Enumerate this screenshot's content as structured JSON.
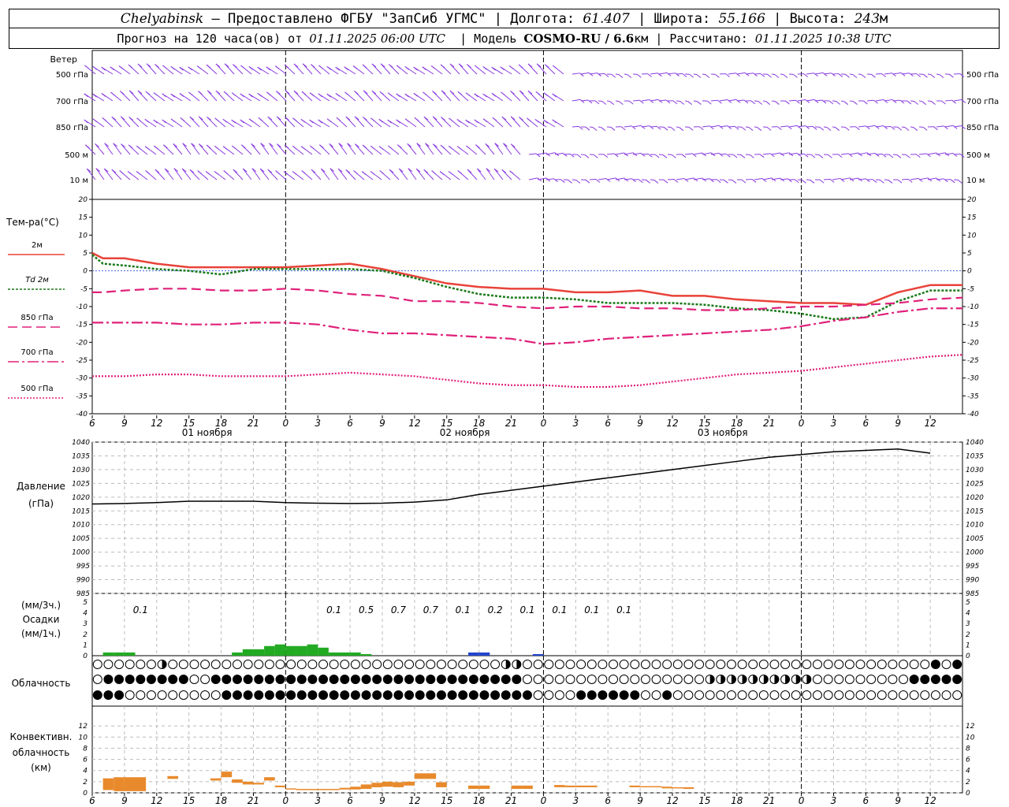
{
  "header": {
    "city": "Chelyabinsk",
    "provider": "– Предоставлено ФГБУ \"ЗапСиб УГМС\"",
    "lon_label": "Долгота:",
    "lon_value": "61.407",
    "lat_label": "Широта:",
    "lat_value": "55.166",
    "alt_label": "Высота:",
    "alt_value": "243",
    "alt_unit": "м",
    "forecast_prefix": "Прогноз на 120 часа(ов) от",
    "forecast_start": "01.11.2025 06:00 UTC",
    "model_label": "Модель",
    "model_name": "COSMO-RU / 6.6",
    "model_unit": "км",
    "calc_label": "Рассчитано:",
    "calc_time": "01.11.2025 10:38 UTC"
  },
  "wind_panel": {
    "title": "Ветер",
    "levels": [
      "500 гПа",
      "700 гПа",
      "850 гПа",
      "500 м",
      "10  м"
    ]
  },
  "temp_panel": {
    "title": "Тем-ра(°С)",
    "legend": [
      {
        "label": "2м",
        "color": "#e8433a",
        "dash": ""
      },
      {
        "label": "Td  2м",
        "color": "#1a7a1a",
        "dash": "3,2"
      },
      {
        "label": "850 гПа",
        "color": "#e0207a",
        "dash": "12,6"
      },
      {
        "label": "700 гПа",
        "color": "#e0207a",
        "dash": "14,4,3,4"
      },
      {
        "label": "500 гПа",
        "color": "#e0207a",
        "dash": "2,2"
      }
    ]
  },
  "pressure_panel": {
    "title": "Давление",
    "unit": "(гПа)"
  },
  "precip_panel": {
    "unit_top": "(мм/3ч.)",
    "title": "Осадки",
    "unit_bottom": "(мм/1ч.)",
    "totals": [
      {
        "hour": 9,
        "text": "0.1"
      },
      {
        "hour": 27,
        "text": "0.1"
      },
      {
        "hour": 30,
        "text": "0.5"
      },
      {
        "hour": 33,
        "text": "0.7"
      },
      {
        "hour": 36,
        "text": "0.7"
      },
      {
        "hour": 39,
        "text": "0.1"
      },
      {
        "hour": 42,
        "text": "0.2"
      },
      {
        "hour": 45,
        "text": "0.1"
      },
      {
        "hour": 48,
        "text": "0.1"
      },
      {
        "hour": 51,
        "text": "0.1"
      },
      {
        "hour": 54,
        "text": "0.1"
      }
    ]
  },
  "cloud_panel": {
    "title": "Облачность"
  },
  "conv_panel": {
    "line1": "Конвективн.",
    "line2": "облачность",
    "line3": "(км)"
  },
  "x_ticks": [
    "6",
    "9",
    "12",
    "15",
    "18",
    "21",
    "0",
    "3",
    "6",
    "9",
    "12",
    "15",
    "18",
    "21",
    "0",
    "3",
    "6",
    "9",
    "12",
    "15",
    "18",
    "21",
    "0",
    "3",
    "6",
    "9",
    "12"
  ],
  "date_labels": [
    {
      "hour": 12,
      "text": "01 ноября"
    },
    {
      "hour": 36,
      "text": "02 ноября"
    },
    {
      "hour": 60,
      "text": "03 ноября"
    }
  ],
  "chart_data": [
    {
      "type": "line",
      "title": "Тем-ра(°С)",
      "x_hours_from_start": [
        0,
        1,
        3,
        6,
        9,
        12,
        15,
        18,
        21,
        24,
        27,
        30,
        33,
        36,
        39,
        42,
        45,
        48,
        51,
        54,
        57,
        60,
        63,
        66,
        69,
        72,
        75,
        78,
        81
      ],
      "x_start": "01.11.2025 06:00 UTC",
      "ylim": [
        -40,
        20
      ],
      "y_ticks": [
        20,
        15,
        10,
        5,
        0,
        -5,
        -10,
        -15,
        -20,
        -25,
        -30,
        -35,
        -40
      ],
      "series": [
        {
          "name": "2м",
          "color": "#e8433a",
          "values": [
            5,
            3.5,
            3.5,
            2,
            1,
            1,
            1,
            1,
            1.5,
            2,
            0.5,
            -1.5,
            -3.5,
            -4.5,
            -5,
            -5,
            -6,
            -6,
            -5.5,
            -7,
            -7,
            -8,
            -8.5,
            -9,
            -9,
            -9.5,
            -6,
            -4,
            -4
          ]
        },
        {
          "name": "Td 2м",
          "color": "#1a7a1a",
          "values": [
            4.5,
            2,
            1.5,
            0.5,
            0,
            -1,
            0.5,
            0.5,
            0.5,
            0.5,
            0,
            -2,
            -4.5,
            -6.5,
            -7.5,
            -7.5,
            -8,
            -9,
            -9,
            -9,
            -9.5,
            -10.5,
            -11,
            -12,
            -13.5,
            -13,
            -8.5,
            -5.5,
            -5.5
          ]
        },
        {
          "name": "850 гПа",
          "color": "#e0207a",
          "values": [
            -6,
            -6,
            -5.5,
            -5,
            -5,
            -5.5,
            -5.5,
            -5,
            -5.5,
            -6.5,
            -7,
            -8.5,
            -8.5,
            -9,
            -10,
            -10.5,
            -10,
            -10,
            -10.5,
            -10.5,
            -11,
            -11,
            -10.5,
            -10,
            -10,
            -9.5,
            -9,
            -8,
            -7.5
          ]
        },
        {
          "name": "700 гПа",
          "color": "#e0207a",
          "values": [
            -14.5,
            -14.5,
            -14.5,
            -14.5,
            -15,
            -15,
            -14.5,
            -14.5,
            -15,
            -16.5,
            -17.5,
            -17.5,
            -18,
            -18.5,
            -19,
            -20.5,
            -20,
            -19,
            -18.5,
            -18,
            -17.5,
            -17,
            -16.5,
            -15.5,
            -14,
            -13,
            -11.5,
            -10.5,
            -10.5
          ]
        },
        {
          "name": "500 гПа",
          "color": "#e0207a",
          "values": [
            -29.5,
            -29.5,
            -29.5,
            -29,
            -29,
            -29.5,
            -29.5,
            -29.5,
            -29,
            -28.5,
            -29,
            -29.5,
            -30.5,
            -31.5,
            -32,
            -32,
            -32.5,
            -32.5,
            -32,
            -31,
            -30,
            -29,
            -28.5,
            -28,
            -27,
            -26,
            -25,
            -24,
            -23.5
          ]
        }
      ]
    },
    {
      "type": "line",
      "title": "Давление",
      "ylabel": "(гПа)",
      "x_hours_from_start": [
        0,
        3,
        6,
        9,
        12,
        15,
        18,
        21,
        24,
        27,
        30,
        33,
        36,
        39,
        42,
        45,
        48,
        51,
        54,
        57,
        60,
        63,
        66,
        69,
        72,
        75,
        78
      ],
      "ylim": [
        985,
        1040
      ],
      "y_ticks": [
        1040,
        1035,
        1030,
        1025,
        1020,
        1015,
        1010,
        1005,
        1000,
        995,
        990,
        985
      ],
      "series": [
        {
          "name": "",
          "color": "#000000",
          "values": [
            1017.5,
            1017.7,
            1018,
            1018.5,
            1018.5,
            1018.5,
            1018,
            1017.8,
            1017.7,
            1017.8,
            1018.2,
            1019,
            1021,
            1022.5,
            1024,
            1025.5,
            1027,
            1028.5,
            1030,
            1031.5,
            1033,
            1034.5,
            1035.5,
            1036.5,
            1037,
            1037.5,
            1036
          ]
        }
      ]
    },
    {
      "type": "bar",
      "title": "Осадки",
      "ylabel": "(мм/1ч.)",
      "ylim": [
        0,
        5
      ],
      "series": [
        {
          "name": "",
          "color": "#22aa22",
          "bars": [
            [
              1,
              0.1
            ],
            [
              2,
              0.1
            ],
            [
              3,
              0.1
            ],
            [
              13,
              0.1
            ],
            [
              14,
              0.2
            ],
            [
              15,
              0.2
            ],
            [
              16,
              0.3
            ],
            [
              17,
              0.35
            ],
            [
              18,
              0.3
            ],
            [
              19,
              0.3
            ],
            [
              20,
              0.35
            ],
            [
              21,
              0.25
            ],
            [
              22,
              0.1
            ],
            [
              23,
              0.1
            ],
            [
              24,
              0.1
            ],
            [
              25,
              0.05
            ]
          ]
        },
        {
          "name": "",
          "color": "#2244cc",
          "bars": [
            [
              35,
              0.1
            ],
            [
              36,
              0.1
            ],
            [
              41,
              0.05
            ]
          ]
        }
      ]
    },
    {
      "type": "bar",
      "title": "Конвективн. облачность",
      "ylabel": "(км)",
      "ylim": [
        0,
        14
      ],
      "y_ticks": [
        12,
        10,
        8,
        6,
        4,
        2,
        0
      ],
      "series": [
        {
          "name": "",
          "color": "#e88a2c",
          "bars": [
            [
              1,
              0.5,
              2.6
            ],
            [
              2,
              0.3,
              2.8
            ],
            [
              3,
              0.3,
              2.8
            ],
            [
              4,
              0.3,
              2.8
            ],
            [
              7,
              2.5,
              3.0
            ],
            [
              11,
              2.2,
              2.6
            ],
            [
              12,
              2.8,
              3.8
            ],
            [
              13,
              1.8,
              2.4
            ],
            [
              14,
              1.5,
              2.0
            ],
            [
              15,
              1.5,
              1.8
            ],
            [
              16,
              2.2,
              2.8
            ],
            [
              17,
              1.0,
              1.3
            ],
            [
              18,
              0.6,
              0.8
            ],
            [
              19,
              0.5,
              0.7
            ],
            [
              20,
              0.5,
              0.7
            ],
            [
              21,
              0.5,
              0.7
            ],
            [
              22,
              0.5,
              0.7
            ],
            [
              23,
              0.6,
              0.9
            ],
            [
              24,
              0.6,
              1.1
            ],
            [
              25,
              0.7,
              1.5
            ],
            [
              26,
              1.0,
              1.8
            ],
            [
              27,
              1.1,
              2.0
            ],
            [
              28,
              1.0,
              1.9
            ],
            [
              29,
              1.3,
              2.0
            ],
            [
              30,
              2.5,
              3.5
            ],
            [
              31,
              2.5,
              3.5
            ],
            [
              32,
              1.0,
              1.9
            ],
            [
              35,
              0.7,
              1.3
            ],
            [
              36,
              0.7,
              1.3
            ],
            [
              39,
              0.7,
              1.3
            ],
            [
              40,
              0.7,
              1.3
            ],
            [
              43,
              1.0,
              1.4
            ],
            [
              44,
              1.0,
              1.3
            ],
            [
              45,
              1.0,
              1.3
            ],
            [
              46,
              1.0,
              1.3
            ],
            [
              50,
              1.0,
              1.3
            ],
            [
              51,
              1.0,
              1.2
            ],
            [
              52,
              1.0,
              1.2
            ],
            [
              53,
              0.8,
              1.1
            ],
            [
              54,
              0.8,
              1.0
            ],
            [
              55,
              0.7,
              1.0
            ]
          ]
        }
      ]
    }
  ]
}
